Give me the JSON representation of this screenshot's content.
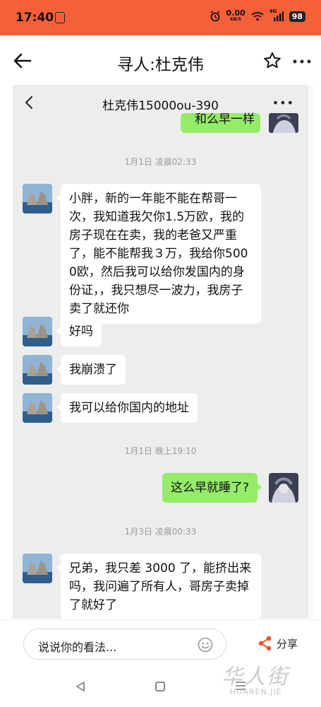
{
  "status_bar": {
    "time": "17:40",
    "net_speed_value": "0.00",
    "net_speed_unit": "KB/S",
    "signal_label": "4G",
    "battery": "98"
  },
  "header": {
    "title": "寻人:杜克伟",
    "icons": [
      "back-arrow-icon",
      "star-icon",
      "more-icon"
    ]
  },
  "chat": {
    "contact_title": "杜克伟15000ou-390",
    "partial_top_text": "和么早一样",
    "messages": [
      {
        "type": "timestamp",
        "text": "1月1日 凌晨02:33"
      },
      {
        "type": "incoming",
        "text": "小胖，新的一年能不能在帮哥一次，我知道我欠你1.5万欧，我的房子现在在卖，我的老爸又严重了，能不能帮我３万，我给你5000欧，然后我可以给你发国内的身份证，，我只想尽一波力，我房子卖了就还你"
      },
      {
        "type": "incoming",
        "text": "好吗"
      },
      {
        "type": "incoming",
        "text": "我崩溃了"
      },
      {
        "type": "incoming",
        "text": "我可以给你国内的地址"
      },
      {
        "type": "timestamp",
        "text": "1月1日 晚上19:10"
      },
      {
        "type": "outgoing",
        "text": "这么早就睡了?"
      },
      {
        "type": "timestamp",
        "text": "1月3日 凌晨00:33"
      },
      {
        "type": "incoming",
        "text": "兄弟，我只差 3000 了，能挤出来吗，我问遍了所有人，哥房子卖掉了就好了"
      }
    ]
  },
  "comment_bar": {
    "placeholder": "说说你的看法...",
    "share_label": "分享"
  },
  "watermark": {
    "main": "华人街",
    "sub": "HUAREN.JIE"
  },
  "colors": {
    "status_bar": "#f5603a",
    "outgoing_bubble": "#95ec69",
    "incoming_bubble": "#ffffff",
    "chat_background": "#ededed",
    "share_icon": "#e8532b"
  }
}
